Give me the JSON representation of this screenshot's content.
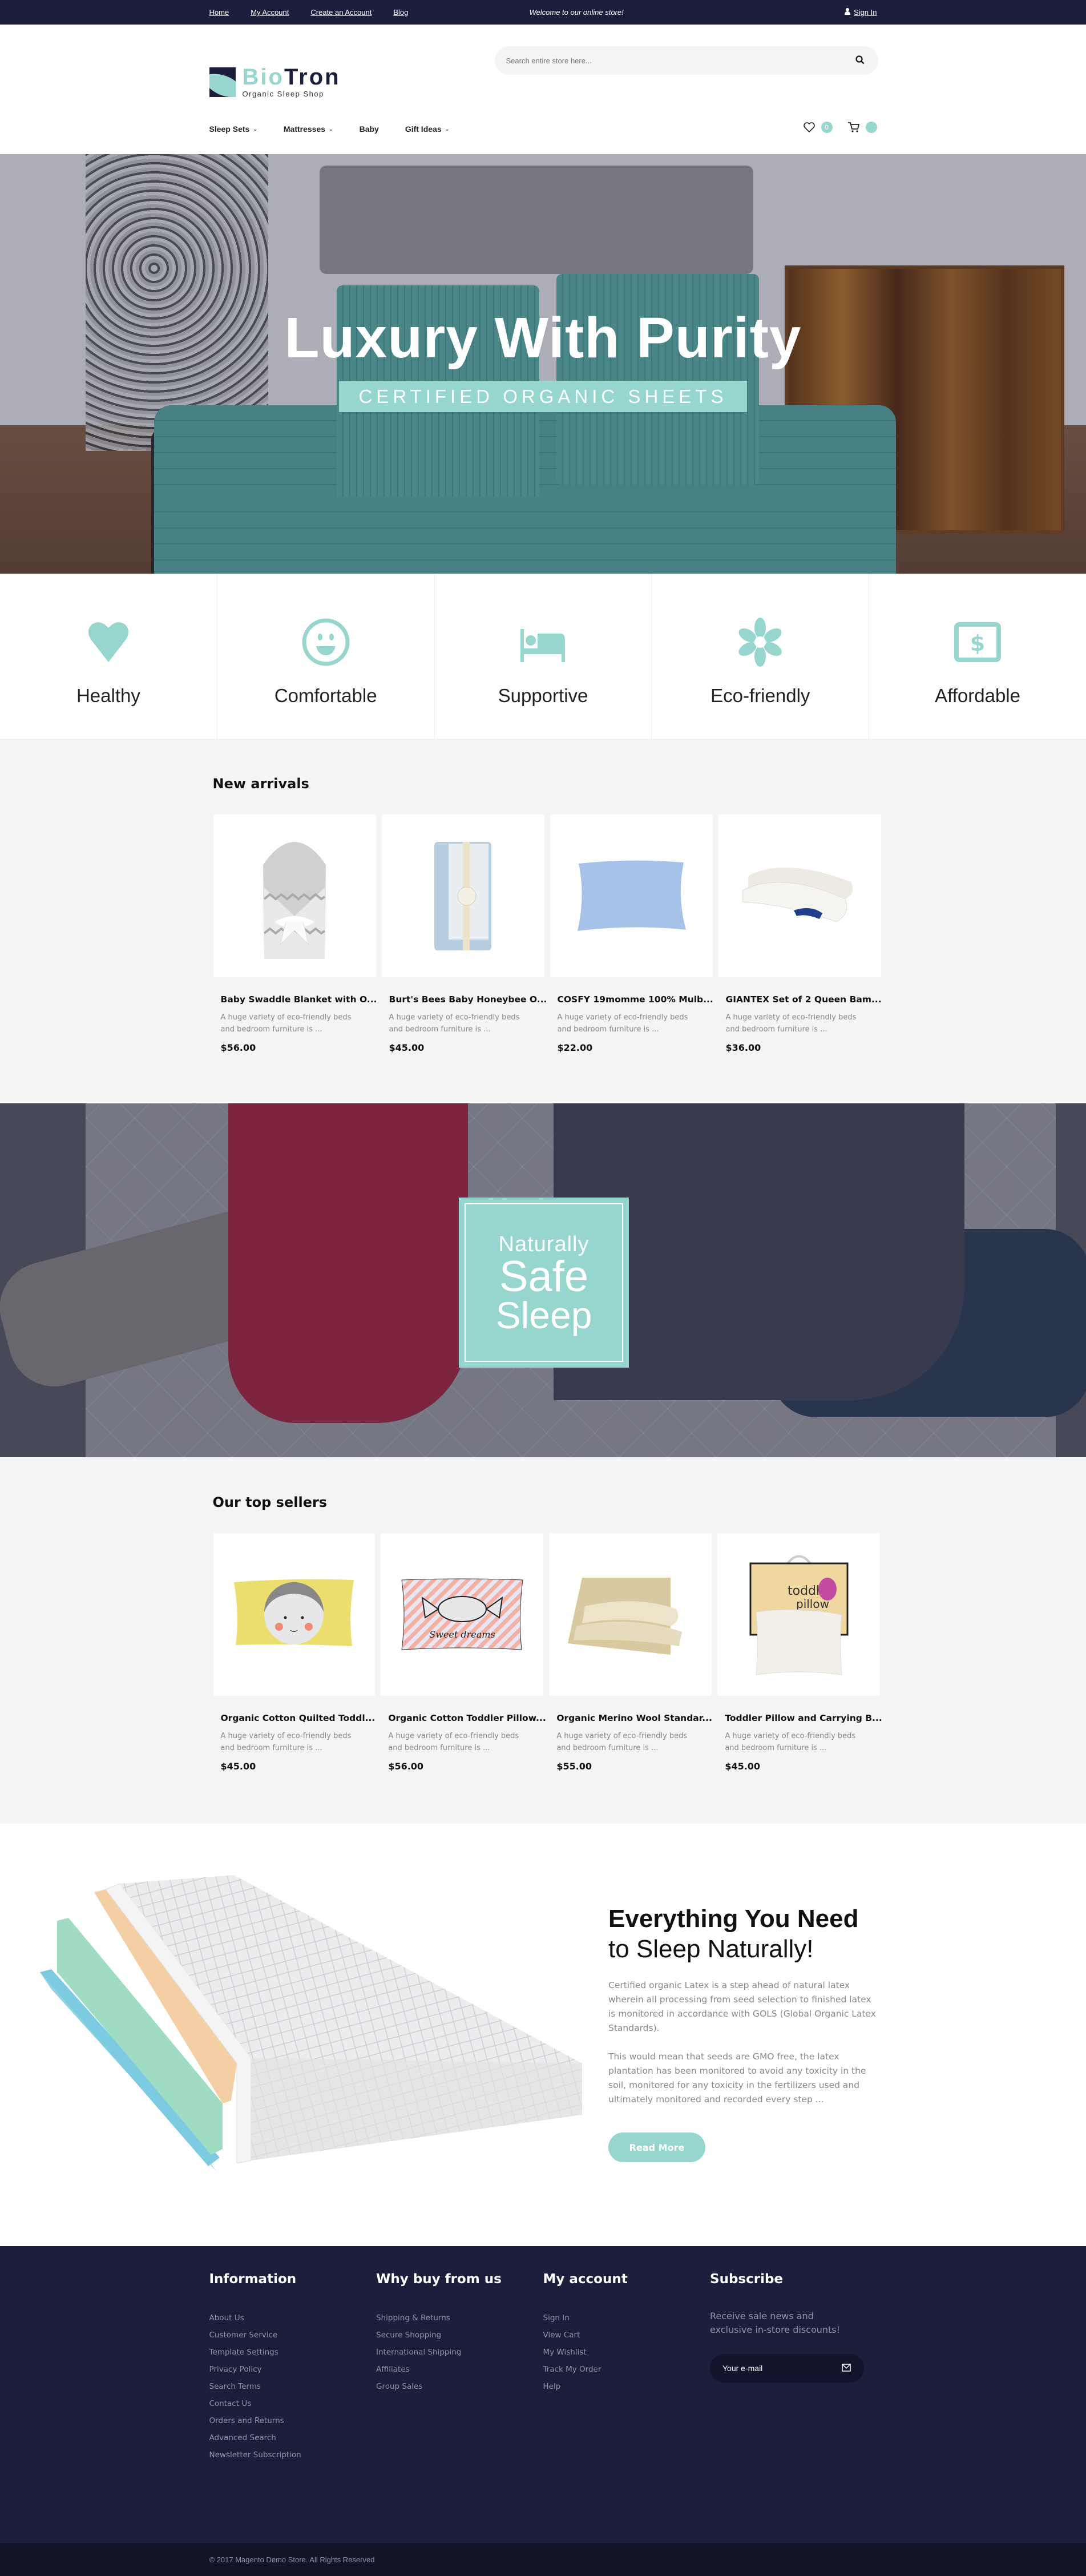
{
  "topbar": {
    "links": [
      "Home",
      "My Account",
      "Create an Account",
      "Blog"
    ],
    "welcome": "Welcome to our online store!",
    "signin": "Sign In",
    "user_icon": "user-icon"
  },
  "header": {
    "logo": {
      "part1": "Bio",
      "part2": "Tron",
      "tagline": "Organic Sleep Shop"
    },
    "search": {
      "placeholder": "Search entire store here...",
      "value": "",
      "icon": "search-icon"
    },
    "nav": [
      {
        "label": "Sleep Sets",
        "dropdown": true
      },
      {
        "label": "Mattresses",
        "dropdown": true
      },
      {
        "label": "Baby",
        "dropdown": false
      },
      {
        "label": "Gift Ideas",
        "dropdown": true
      }
    ],
    "chevron": "⌄",
    "wishlist": {
      "icon": "heart-outline-icon",
      "count": "0"
    },
    "cart": {
      "icon": "cart-icon",
      "count": ""
    }
  },
  "hero": {
    "title": "Luxury With Purity",
    "subtitle": "CERTIFIED ORGANIC SHEETS"
  },
  "features": [
    {
      "icon": "heart-icon",
      "label": "Healthy"
    },
    {
      "icon": "smiley-icon",
      "label": "Comfortable"
    },
    {
      "icon": "bed-icon",
      "label": "Supportive"
    },
    {
      "icon": "flower-icon",
      "label": "Eco-friendly"
    },
    {
      "icon": "dollar-bill-icon",
      "label": "Affordable"
    }
  ],
  "new_arrivals": {
    "title": "New arrivals",
    "products": [
      {
        "name": "Baby Swaddle Blanket with O...",
        "desc": "A huge variety of eco-friendly beds and bedroom furniture is ...",
        "price": "$56.00",
        "image": "swaddle-blanket"
      },
      {
        "name": "Burt's Bees Baby Honeybee O...",
        "desc": "A huge variety of eco-friendly beds and bedroom furniture is ...",
        "price": "$45.00",
        "image": "folded-blanket"
      },
      {
        "name": "COSFY 19momme 100% Mulb...",
        "desc": "A huge variety of eco-friendly beds and bedroom furniture is ...",
        "price": "$22.00",
        "image": "silk-pillowcase"
      },
      {
        "name": "GIANTEX Set of 2 Queen Bam...",
        "desc": "A huge variety of eco-friendly beds and bedroom furniture is ...",
        "price": "$36.00",
        "image": "bamboo-pillows"
      }
    ]
  },
  "banner": {
    "line1": "Naturally",
    "line2": "Safe",
    "line3": "Sleep"
  },
  "top_sellers": {
    "title": "Our top sellers",
    "products": [
      {
        "name": "Organic Cotton Quilted Toddl...",
        "desc": "A huge variety of eco-friendly beds and bedroom furniture is ...",
        "price": "$45.00",
        "image": "yellow-face-pillow"
      },
      {
        "name": "Organic Cotton Toddler Pillow...",
        "desc": "A huge variety of eco-friendly beds and bedroom furniture is ...",
        "price": "$56.00",
        "image": "sweet-dreams-pillow"
      },
      {
        "name": "Organic Merino Wool Standar...",
        "desc": "A huge variety of eco-friendly beds and bedroom furniture is ...",
        "price": "$55.00",
        "image": "wool-pillows"
      },
      {
        "name": "Toddler Pillow and Carrying B...",
        "desc": "A huge variety of eco-friendly beds and bedroom furniture is ...",
        "price": "$45.00",
        "image": "toddler-pillow-bag"
      }
    ]
  },
  "promo": {
    "heading1": "Everything You Need",
    "heading2": "to Sleep Naturally!",
    "p1": "Certified organic Latex is a step ahead of natural latex wherein all processing from seed selection to finished latex is monitored in accordance with GOLS (Global Organic Latex Standards).",
    "p2": "This would mean that seeds are GMO free, the latex plantation has been monitored to avoid any toxicity in the soil, monitored for any toxicity in the fertilizers used and ultimately monitored and recorded every step ...",
    "button": "Read More"
  },
  "footer": {
    "columns": [
      {
        "title": "Information",
        "links": [
          "About Us",
          "Customer Service",
          "Template Settings",
          "Privacy Policy",
          "Search Terms",
          "Contact Us",
          "Orders and Returns",
          "Advanced Search",
          "Newsletter Subscription"
        ]
      },
      {
        "title": "Why buy from us",
        "links": [
          "Shipping & Returns",
          "Secure Shopping",
          "International Shipping",
          "Affiliates",
          "Group Sales"
        ]
      },
      {
        "title": "My account",
        "links": [
          "Sign In",
          "View Cart",
          "My Wishlist",
          "Track My Order",
          "Help"
        ]
      }
    ],
    "subscribe": {
      "title": "Subscribe",
      "text": "Receive sale news and exclusive in-store discounts!",
      "placeholder": "Your e-mail",
      "icon": "envelope-icon"
    },
    "copyright": "© 2017 Magento Demo Store. All Rights Reserved"
  },
  "colors": {
    "accent": "#97d5cf",
    "navy": "#1b1f3b",
    "footer_bottom": "#121428",
    "section_bg": "#f4f4f4"
  }
}
